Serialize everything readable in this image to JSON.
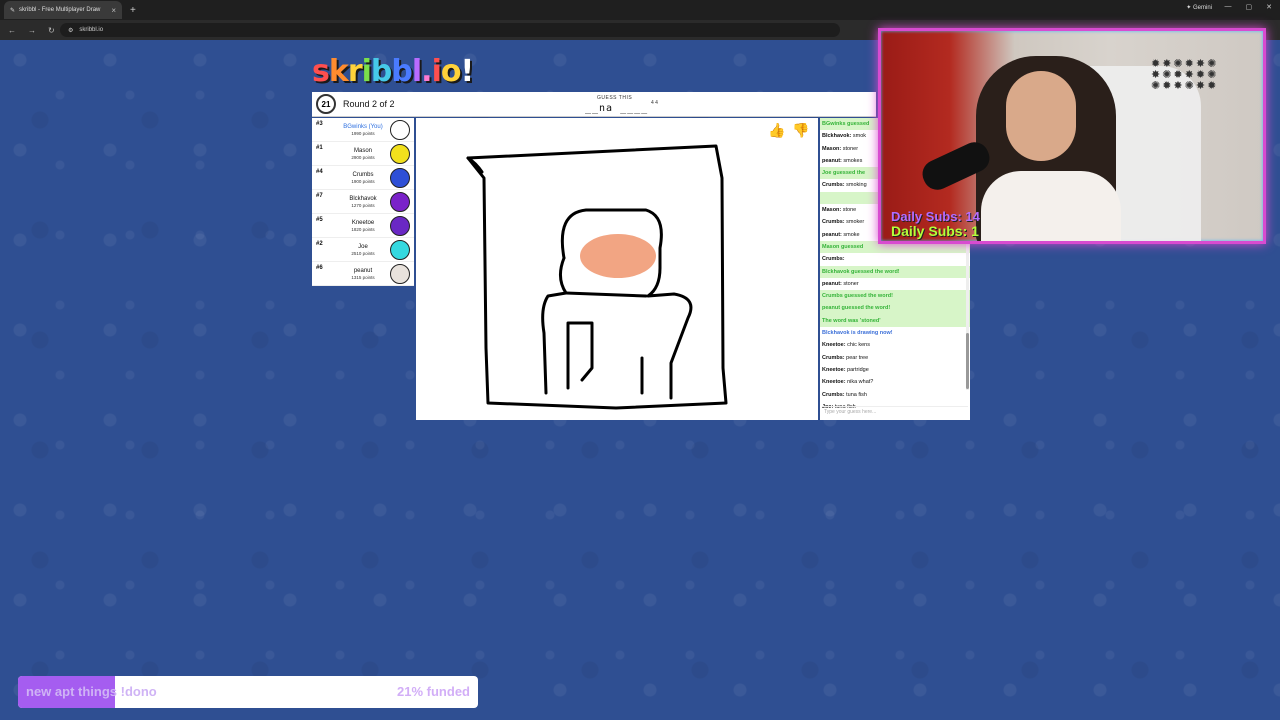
{
  "browser": {
    "tab_title": "skribbl - Free Multiplayer Draw",
    "url": "skribbl.io",
    "gemini_label": "Gemini"
  },
  "logo_letters": [
    {
      "ch": "s",
      "color": "#ff4f4f"
    },
    {
      "ch": "k",
      "color": "#ff8c2e"
    },
    {
      "ch": "r",
      "color": "#ffd23a"
    },
    {
      "ch": "i",
      "color": "#7be04b"
    },
    {
      "ch": "b",
      "color": "#46c9e8"
    },
    {
      "ch": "b",
      "color": "#4a7bff"
    },
    {
      "ch": "l",
      "color": "#b86bff"
    },
    {
      "ch": ".",
      "color": "#ff7ad1"
    },
    {
      "ch": "i",
      "color": "#ff4f4f"
    },
    {
      "ch": "o",
      "color": "#ffd23a"
    },
    {
      "ch": "!",
      "color": "#ffffff"
    }
  ],
  "game": {
    "timer": "21",
    "round_text": "Round 2 of 2",
    "guess_label": "GUESS THIS",
    "word_hint": "__na ____",
    "word_lengths": "4 4"
  },
  "players": [
    {
      "rank": "#3",
      "name": "BGwinks (You)",
      "points": "1990 points",
      "avatar_color": "#ffffff",
      "me": true
    },
    {
      "rank": "#1",
      "name": "Mason",
      "points": "2900 points",
      "avatar_color": "#f2e01c",
      "me": false
    },
    {
      "rank": "#4",
      "name": "Crumbs",
      "points": "1900 points",
      "avatar_color": "#2e4fd6",
      "me": false
    },
    {
      "rank": "#7",
      "name": "Blckhavok",
      "points": "1270 points",
      "avatar_color": "#7a22c9",
      "me": false
    },
    {
      "rank": "#5",
      "name": "Kneetoe",
      "points": "1820 points",
      "avatar_color": "#6a28c4",
      "me": false
    },
    {
      "rank": "#2",
      "name": "Joe",
      "points": "2510 points",
      "avatar_color": "#35d9e0",
      "me": false
    },
    {
      "rank": "#6",
      "name": "peanut",
      "points": "1315 points",
      "avatar_color": "#e8e2dc",
      "me": false
    }
  ],
  "chat": [
    {
      "type": "green",
      "sender": "",
      "text": "BGwinks guessed"
    },
    {
      "type": "normal",
      "sender": "Blckhavok:",
      "text": "smok"
    },
    {
      "type": "normal",
      "sender": "Mason:",
      "text": "stoner"
    },
    {
      "type": "normal",
      "sender": "peanut:",
      "text": "smokes"
    },
    {
      "type": "green",
      "sender": "",
      "text": "Joe guessed the"
    },
    {
      "type": "normal",
      "sender": "Crumbs:",
      "text": "smoking"
    },
    {
      "type": "green",
      "sender": "",
      "text": ""
    },
    {
      "type": "normal",
      "sender": "Mason:",
      "text": "stone"
    },
    {
      "type": "normal",
      "sender": "Crumbs:",
      "text": "smoker"
    },
    {
      "type": "normal",
      "sender": "peanut:",
      "text": "smoke"
    },
    {
      "type": "green",
      "sender": "",
      "text": "Mason guessed"
    },
    {
      "type": "normal",
      "sender": "Crumbs:",
      "text": ""
    },
    {
      "type": "green",
      "sender": "",
      "text": "Blckhavok guessed the word!"
    },
    {
      "type": "normal",
      "sender": "peanut:",
      "text": "stoner"
    },
    {
      "type": "green",
      "sender": "",
      "text": "Crumbs guessed the word!"
    },
    {
      "type": "green",
      "sender": "",
      "text": "peanut guessed the word!"
    },
    {
      "type": "green",
      "sender": "",
      "text": "The word was 'stoned'"
    },
    {
      "type": "blue",
      "sender": "",
      "text": "Blckhavok is drawing now!"
    },
    {
      "type": "normal",
      "sender": "Kneetoe:",
      "text": "chic kens"
    },
    {
      "type": "normal",
      "sender": "Crumbs:",
      "text": "pear tree"
    },
    {
      "type": "normal",
      "sender": "Kneetoe:",
      "text": "partridge"
    },
    {
      "type": "normal",
      "sender": "Kneetoe:",
      "text": "nika what?"
    },
    {
      "type": "normal",
      "sender": "Crumbs:",
      "text": "tuna fish"
    },
    {
      "type": "normal",
      "sender": "Joe:",
      "text": "tuna fish"
    }
  ],
  "chat_input_placeholder": "Type your guess here...",
  "stream": {
    "subs_total": "Daily Subs: 14",
    "subs_today": "Daily Subs: 1"
  },
  "donation": {
    "label": "new apt things !dono",
    "funded_text": "21% funded",
    "progress": 0.21,
    "fill_color": "#a55df0"
  }
}
